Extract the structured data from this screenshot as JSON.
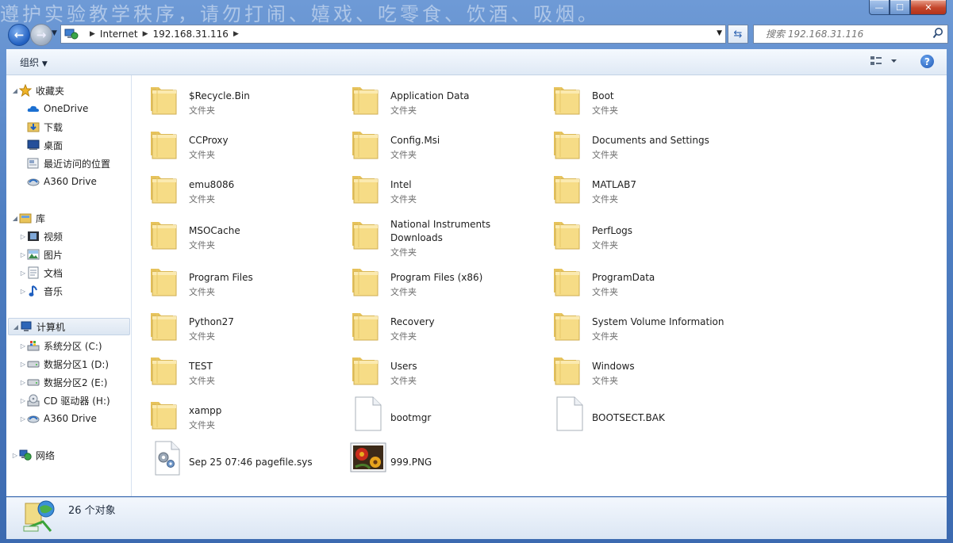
{
  "window": {
    "caption_text": "遵护实验教学秩序，请勿打闹、嬉戏、吃零食、饮酒、吸烟。",
    "min_symbol": "—",
    "max_symbol": "☐",
    "close_symbol": "✕"
  },
  "address": {
    "back_symbol": "←",
    "forward_symbol": "→",
    "crumbs": [
      "Internet",
      "192.168.31.116"
    ],
    "search_placeholder": "搜索 192.168.31.116"
  },
  "toolbar": {
    "organize_label": "组织",
    "help_symbol": "?"
  },
  "nav": {
    "favorites": {
      "label": "收藏夹",
      "items": [
        "OneDrive",
        "下载",
        "桌面",
        "最近访问的位置",
        "A360 Drive"
      ]
    },
    "library": {
      "label": "库",
      "items": [
        "视频",
        "图片",
        "文档",
        "音乐"
      ]
    },
    "computer": {
      "label": "计算机",
      "items": [
        "系统分区 (C:)",
        "数据分区1 (D:)",
        "数据分区2 (E:)",
        "CD 驱动器 (H:)",
        "A360 Drive"
      ]
    },
    "network": {
      "label": "网络"
    }
  },
  "files": [
    {
      "name": "$Recycle.Bin",
      "type": "文件夹",
      "icon": "folder"
    },
    {
      "name": "Application Data",
      "type": "文件夹",
      "icon": "folder"
    },
    {
      "name": "Boot",
      "type": "文件夹",
      "icon": "folder"
    },
    {
      "name": "CCProxy",
      "type": "文件夹",
      "icon": "folder"
    },
    {
      "name": "Config.Msi",
      "type": "文件夹",
      "icon": "folder"
    },
    {
      "name": "Documents and Settings",
      "type": "文件夹",
      "icon": "folder"
    },
    {
      "name": "emu8086",
      "type": "文件夹",
      "icon": "folder"
    },
    {
      "name": "Intel",
      "type": "文件夹",
      "icon": "folder"
    },
    {
      "name": "MATLAB7",
      "type": "文件夹",
      "icon": "folder"
    },
    {
      "name": "MSOCache",
      "type": "文件夹",
      "icon": "folder"
    },
    {
      "name": "National Instruments Downloads",
      "type": "文件夹",
      "icon": "folder"
    },
    {
      "name": "PerfLogs",
      "type": "文件夹",
      "icon": "folder"
    },
    {
      "name": "Program Files",
      "type": "文件夹",
      "icon": "folder"
    },
    {
      "name": "Program Files (x86)",
      "type": "文件夹",
      "icon": "folder"
    },
    {
      "name": "ProgramData",
      "type": "文件夹",
      "icon": "folder"
    },
    {
      "name": "Python27",
      "type": "文件夹",
      "icon": "folder"
    },
    {
      "name": "Recovery",
      "type": "文件夹",
      "icon": "folder"
    },
    {
      "name": "System Volume Information",
      "type": "文件夹",
      "icon": "folder"
    },
    {
      "name": "TEST",
      "type": "文件夹",
      "icon": "folder"
    },
    {
      "name": "Users",
      "type": "文件夹",
      "icon": "folder"
    },
    {
      "name": "Windows",
      "type": "文件夹",
      "icon": "folder"
    },
    {
      "name": "xampp",
      "type": "文件夹",
      "icon": "folder"
    },
    {
      "name": "bootmgr",
      "type": "",
      "icon": "file"
    },
    {
      "name": "BOOTSECT.BAK",
      "type": "",
      "icon": "file"
    },
    {
      "name": "Sep 25 07:46 pagefile.sys",
      "type": "",
      "icon": "system-file"
    },
    {
      "name": "999.PNG",
      "type": "",
      "icon": "image"
    }
  ],
  "status": {
    "count_text": "26 个对象"
  }
}
